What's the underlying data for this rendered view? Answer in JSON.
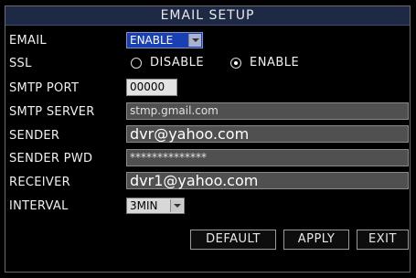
{
  "window": {
    "title": "EMAIL SETUP"
  },
  "form": {
    "email": {
      "label": "EMAIL",
      "value": "ENABLE"
    },
    "ssl": {
      "label": "SSL",
      "options": [
        "DISABLE",
        "ENABLE"
      ],
      "selected": "ENABLE"
    },
    "smtp_port": {
      "label": "SMTP PORT",
      "value": "00000"
    },
    "smtp_server": {
      "label": "SMTP SERVER",
      "value": "stmp.gmail.com"
    },
    "sender": {
      "label": "SENDER",
      "value": "dvr@yahoo.com"
    },
    "sender_pwd": {
      "label": "SENDER PWD",
      "value": "**************"
    },
    "receiver": {
      "label": "RECEIVER",
      "value": "dvr1@yahoo.com"
    },
    "interval": {
      "label": "INTERVAL",
      "value": "3MIN"
    }
  },
  "buttons": {
    "default": "DEFAULT",
    "apply": "APPLY",
    "exit": "EXIT"
  }
}
